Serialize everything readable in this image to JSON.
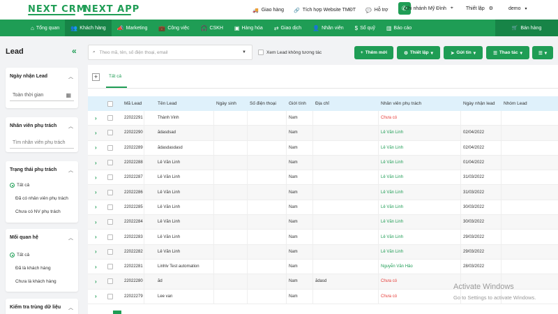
{
  "brand": {
    "crm": "NEXT CRM",
    "app": "NEXT APP"
  },
  "top_links": [
    {
      "icon": "cart-icon",
      "label": "Giao hàng"
    },
    {
      "icon": "link-icon",
      "label": "Tích hợp Website TMĐT"
    },
    {
      "icon": "chat-icon",
      "label": "Hỗ trợ"
    }
  ],
  "branch": {
    "label": "Chi nhánh Mỹ Đình",
    "icon": "location-icon"
  },
  "settings_label": "Thiết lập",
  "user": "demo",
  "nav": [
    {
      "icon": "home-icon",
      "label": "Tổng quan"
    },
    {
      "icon": "users-icon",
      "label": "Khách hàng"
    },
    {
      "icon": "megaphone-icon",
      "label": "Marketing"
    },
    {
      "icon": "briefcase-icon",
      "label": "Công việc"
    },
    {
      "icon": "headset-icon",
      "label": "CSKH"
    },
    {
      "icon": "box-icon",
      "label": "Hàng hóa"
    },
    {
      "icon": "exchange-icon",
      "label": "Giao dịch"
    },
    {
      "icon": "person-icon",
      "label": "Nhân viên"
    },
    {
      "icon": "dollar-icon",
      "label": "Sổ quỹ"
    },
    {
      "icon": "chart-icon",
      "label": "Báo cáo"
    }
  ],
  "nav_sales": "Bán hàng",
  "page_title": "Lead",
  "filters": {
    "date": {
      "title": "Ngày nhận Lead",
      "value": "Toàn thời gian"
    },
    "staff": {
      "title": "Nhân viên phụ trách",
      "placeholder": "Tìm nhân viên phụ trách"
    },
    "status": {
      "title": "Trạng thái phụ trách",
      "options": [
        "Tất cả",
        "Đã có nhân viên phụ trách",
        "Chưa có NV phụ trách"
      ]
    },
    "relation": {
      "title": "Mối quan hệ",
      "options": [
        "Tất cả",
        "Đã là khách hàng",
        "Chưa là khách hàng"
      ]
    },
    "dup": {
      "title": "Kiểm tra trùng dữ liệu"
    }
  },
  "search": {
    "placeholder": "Theo mã, tên, số điện thoại, email"
  },
  "similar_lead": "Xem Lead không tương tác",
  "toolbar": {
    "add": "Thêm mới",
    "setup": "Thiết lập",
    "send": "Gửi tin",
    "actions": "Thao tác"
  },
  "tabs": {
    "all": "Tất cả"
  },
  "columns": [
    "Mã Lead",
    "Tên Lead",
    "Ngày sinh",
    "Số điện thoại",
    "Giới tính",
    "Địa chỉ",
    "Nhân viên phụ trách",
    "Ngày nhận lead",
    "Nhóm Lead"
  ],
  "rows": [
    {
      "code": "22022291",
      "name": "Thành Vinh",
      "gender": "Nam",
      "address": "",
      "staff": "Chưa có",
      "staff_color": "red",
      "date": ""
    },
    {
      "code": "22022290",
      "name": "ădasdsad",
      "gender": "Nam",
      "address": "",
      "staff": "Lê Văn Linh",
      "staff_color": "green",
      "date": "02/04/2022"
    },
    {
      "code": "22022289",
      "name": "ădasdasdasd",
      "gender": "Nam",
      "address": "",
      "staff": "Lê Văn Linh",
      "staff_color": "green",
      "date": "02/04/2022"
    },
    {
      "code": "22022288",
      "name": "Lê Văn Linh",
      "gender": "Nam",
      "address": "",
      "staff": "Lê Văn Linh",
      "staff_color": "green",
      "date": "01/04/2022"
    },
    {
      "code": "22022287",
      "name": "Lê Văn Linh",
      "gender": "Nam",
      "address": "",
      "staff": "Lê Văn Linh",
      "staff_color": "green",
      "date": "31/03/2022"
    },
    {
      "code": "22022286",
      "name": "Lê Văn Linh",
      "gender": "Nam",
      "address": "",
      "staff": "Lê Văn Linh",
      "staff_color": "green",
      "date": "31/03/2022"
    },
    {
      "code": "22022285",
      "name": "Lê Văn Linh",
      "gender": "Nam",
      "address": "",
      "staff": "Lê Văn Linh",
      "staff_color": "green",
      "date": "30/03/2022"
    },
    {
      "code": "22022284",
      "name": "Lê Văn Linh",
      "gender": "Nam",
      "address": "",
      "staff": "Lê Văn Linh",
      "staff_color": "green",
      "date": "30/03/2022"
    },
    {
      "code": "22022283",
      "name": "Lê Văn Linh",
      "gender": "Nam",
      "address": "",
      "staff": "Lê Văn Linh",
      "staff_color": "green",
      "date": "29/03/2022"
    },
    {
      "code": "22022282",
      "name": "Lê Văn Linh",
      "gender": "Nam",
      "address": "",
      "staff": "Lê Văn Linh",
      "staff_color": "green",
      "date": "29/03/2022"
    },
    {
      "code": "22022281",
      "name": "Linhlv Test automation",
      "gender": "Nam",
      "address": "",
      "staff": "Nguyễn Văn Hảo",
      "staff_color": "green",
      "date": "28/03/2022"
    },
    {
      "code": "22022280",
      "name": "ăd",
      "gender": "Nam",
      "address": "ădasd",
      "staff": "Chưa có",
      "staff_color": "red",
      "date": ""
    },
    {
      "code": "22022279",
      "name": "Lee van",
      "gender": "Nam",
      "address": "",
      "staff": "Chưa có",
      "staff_color": "red",
      "date": ""
    }
  ],
  "watermark": {
    "title": "Activate Windows",
    "sub": "Go to Settings to activate Windows."
  },
  "colors": {
    "primary": "#1f9d55",
    "primary_dark": "#178447",
    "danger": "#e53935",
    "header_bg": "#dff1fb"
  }
}
